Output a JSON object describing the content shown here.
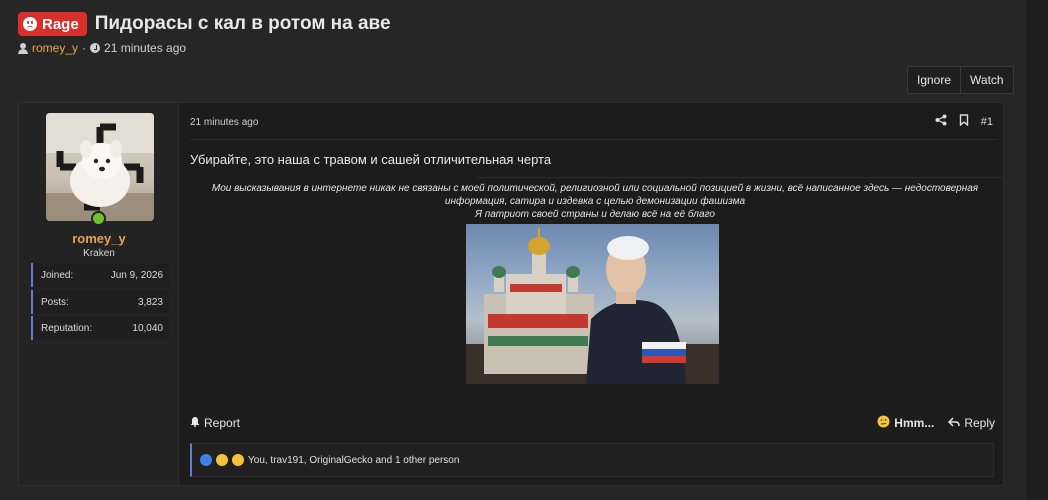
{
  "thread": {
    "prefix": "Rage",
    "title": "Пидорасы с кал в ротом на аве",
    "author": "romey_y",
    "separator": "·",
    "time": "21 minutes ago"
  },
  "top_buttons": {
    "ignore": "Ignore",
    "watch": "Watch"
  },
  "colors": {
    "prefix_bg": "#d9302c",
    "username": "#e8a24c",
    "accent": "#6a79c8",
    "online": "#6fc12a"
  },
  "post": {
    "user": {
      "name": "romey_y",
      "title": "Kraken",
      "stats": [
        {
          "label": "Joined:",
          "value": "Jun 9, 2026"
        },
        {
          "label": "Posts:",
          "value": "3,823"
        },
        {
          "label": "Reputation:",
          "value": "10,040"
        }
      ]
    },
    "time": "21 minutes ago",
    "number": "#1",
    "message": "Убирайте, это наша с травом и сашей отличительная черта",
    "signature": {
      "line1": "Мои высказывания в интернете никак не связаны с моей политической, религиозной или социальной позицией в жизни, всё написанное здесь — недостоверная",
      "line2": "информация, сатира и издевка с целью демонизации фашизма",
      "line3": "Я патриот своей страны и делаю всё на её благо"
    },
    "actions": {
      "report": "Report",
      "hmm": "Hmm...",
      "reply": "Reply"
    },
    "reactions_text": "You, trav191, OriginalGecko and 1 other person"
  }
}
